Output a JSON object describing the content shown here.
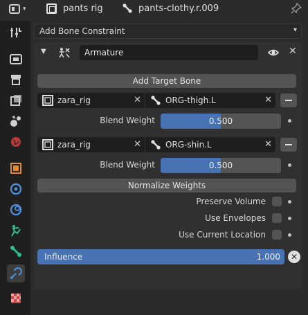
{
  "header": {
    "object_name": "pants rig",
    "bone_name": "pants-clothy.r.009"
  },
  "tabs": [
    {
      "icon": "tool-icon"
    },
    {
      "icon": "render-icon"
    },
    {
      "icon": "output-icon"
    },
    {
      "icon": "view-layer-icon"
    },
    {
      "icon": "scene-icon"
    },
    {
      "icon": "world-icon"
    },
    {
      "icon": "object-icon"
    },
    {
      "icon": "modifier-icon"
    },
    {
      "icon": "physics-icon"
    },
    {
      "icon": "object-constraint-icon"
    },
    {
      "icon": "bone-icon"
    },
    {
      "icon": "bone-constraint-icon",
      "active": true
    },
    {
      "icon": "texture-icon"
    }
  ],
  "add_constraint_label": "Add Bone Constraint",
  "constraint": {
    "name": "Armature",
    "add_target_label": "Add Target Bone",
    "targets": [
      {
        "object": "zara_rig",
        "bone": "ORG-thigh.L",
        "weight_label": "Blend Weight",
        "weight": "0.500",
        "weight_fraction": 0.5
      },
      {
        "object": "zara_rig",
        "bone": "ORG-shin.L",
        "weight_label": "Blend Weight",
        "weight": "0.500",
        "weight_fraction": 0.5
      }
    ],
    "normalize_label": "Normalize Weights",
    "options": [
      {
        "label": "Preserve Volume",
        "checked": false
      },
      {
        "label": "Use Envelopes",
        "checked": false
      },
      {
        "label": "Use Current Location",
        "checked": false
      }
    ],
    "influence_label": "Influence",
    "influence": "1.000",
    "influence_fraction": 1.0
  },
  "colors": {
    "accent": "#4772b3",
    "panel": "#303030",
    "background": "#2b2b2b"
  }
}
